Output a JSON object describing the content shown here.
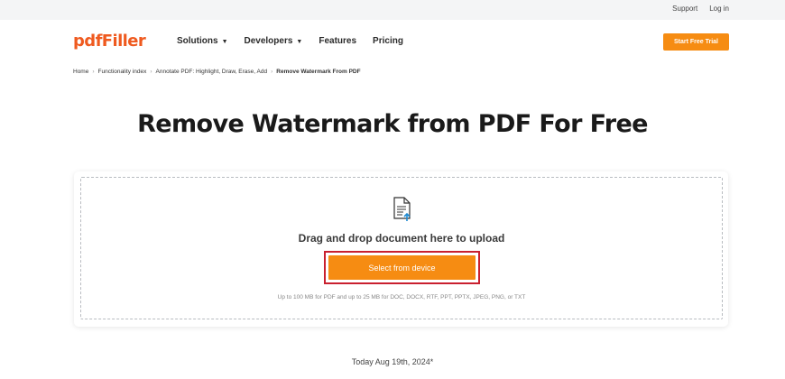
{
  "topbar": {
    "support": "Support",
    "login": "Log in"
  },
  "header": {
    "logo": "pdfFiller",
    "nav": [
      {
        "label": "Solutions",
        "chevron": true
      },
      {
        "label": "Developers",
        "chevron": true
      },
      {
        "label": "Features",
        "chevron": false
      },
      {
        "label": "Pricing",
        "chevron": false
      }
    ],
    "cta": "Start Free Trial"
  },
  "breadcrumb": {
    "items": [
      "Home",
      "Functionality index",
      "Annotate PDF: Highlight, Draw, Erase, Add",
      "Remove Watermark From PDF"
    ],
    "separator": "›"
  },
  "page": {
    "title": "Remove Watermark from PDF For Free",
    "upload": {
      "icon": "document-upload-icon",
      "drop_text": "Drag and drop document here to upload",
      "button": "Select from device",
      "limits": "Up to 100 MB for PDF and up to 25 MB for DOC, DOCX, RTF, PPT, PPTX, JPEG, PNG, or TXT"
    },
    "date": "Today Aug 19th, 2024*"
  },
  "colors": {
    "brand": "#ef5a1f",
    "accent": "#f68c12",
    "highlight": "#c9202f"
  }
}
